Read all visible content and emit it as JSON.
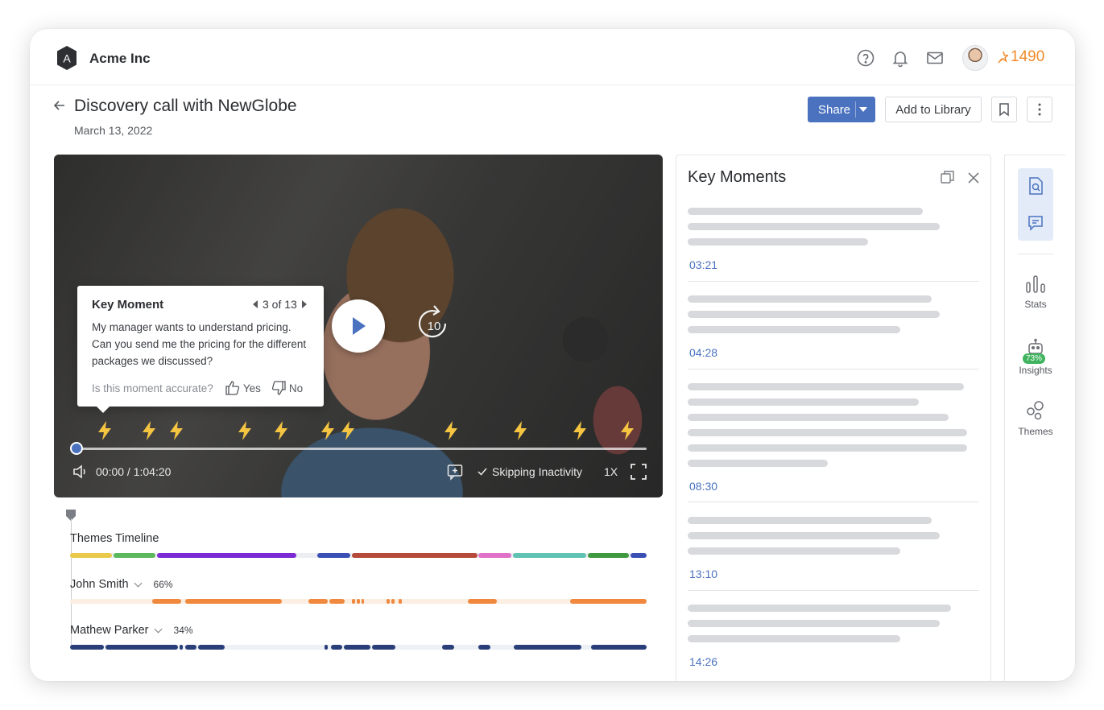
{
  "app": {
    "company": "Acme Inc",
    "logo_letter": "A",
    "points": "1490",
    "brand_color": "#4a72bf",
    "accent_color": "#f08b2a"
  },
  "header": {
    "title": "Discovery call with NewGlobe",
    "date": "March 13, 2022",
    "share_label": "Share",
    "add_library_label": "Add to Library"
  },
  "video": {
    "time": "00:00 / 1:04:20",
    "skip_label": "Skipping Inactivity",
    "speed": "1X",
    "replay_seconds": "10",
    "progress": 0
  },
  "key_moment_popup": {
    "title": "Key Moment",
    "nav": "3 of 13",
    "body": "My manager wants to understand pricing. Can you send me the pricing for the different packages we discussed?",
    "question": "Is this moment accurate?",
    "yes": "Yes",
    "no": "No"
  },
  "timeline": {
    "themes_label": "Themes Timeline",
    "speakers": [
      {
        "name": "John Smith",
        "pct": "66%",
        "color": "#f0883e"
      },
      {
        "name": "Mathew Parker",
        "pct": "34%",
        "color": "#2a3f7a"
      }
    ]
  },
  "key_moments_panel": {
    "title": "Key Moments",
    "items": [
      {
        "time": "03:21"
      },
      {
        "time": "04:28"
      },
      {
        "time": "08:30"
      },
      {
        "time": "13:10"
      },
      {
        "time": "14:26"
      }
    ]
  },
  "rail": {
    "stats_label": "Stats",
    "insights_label": "Insights",
    "insights_badge": "73%",
    "themes_label": "Themes"
  }
}
